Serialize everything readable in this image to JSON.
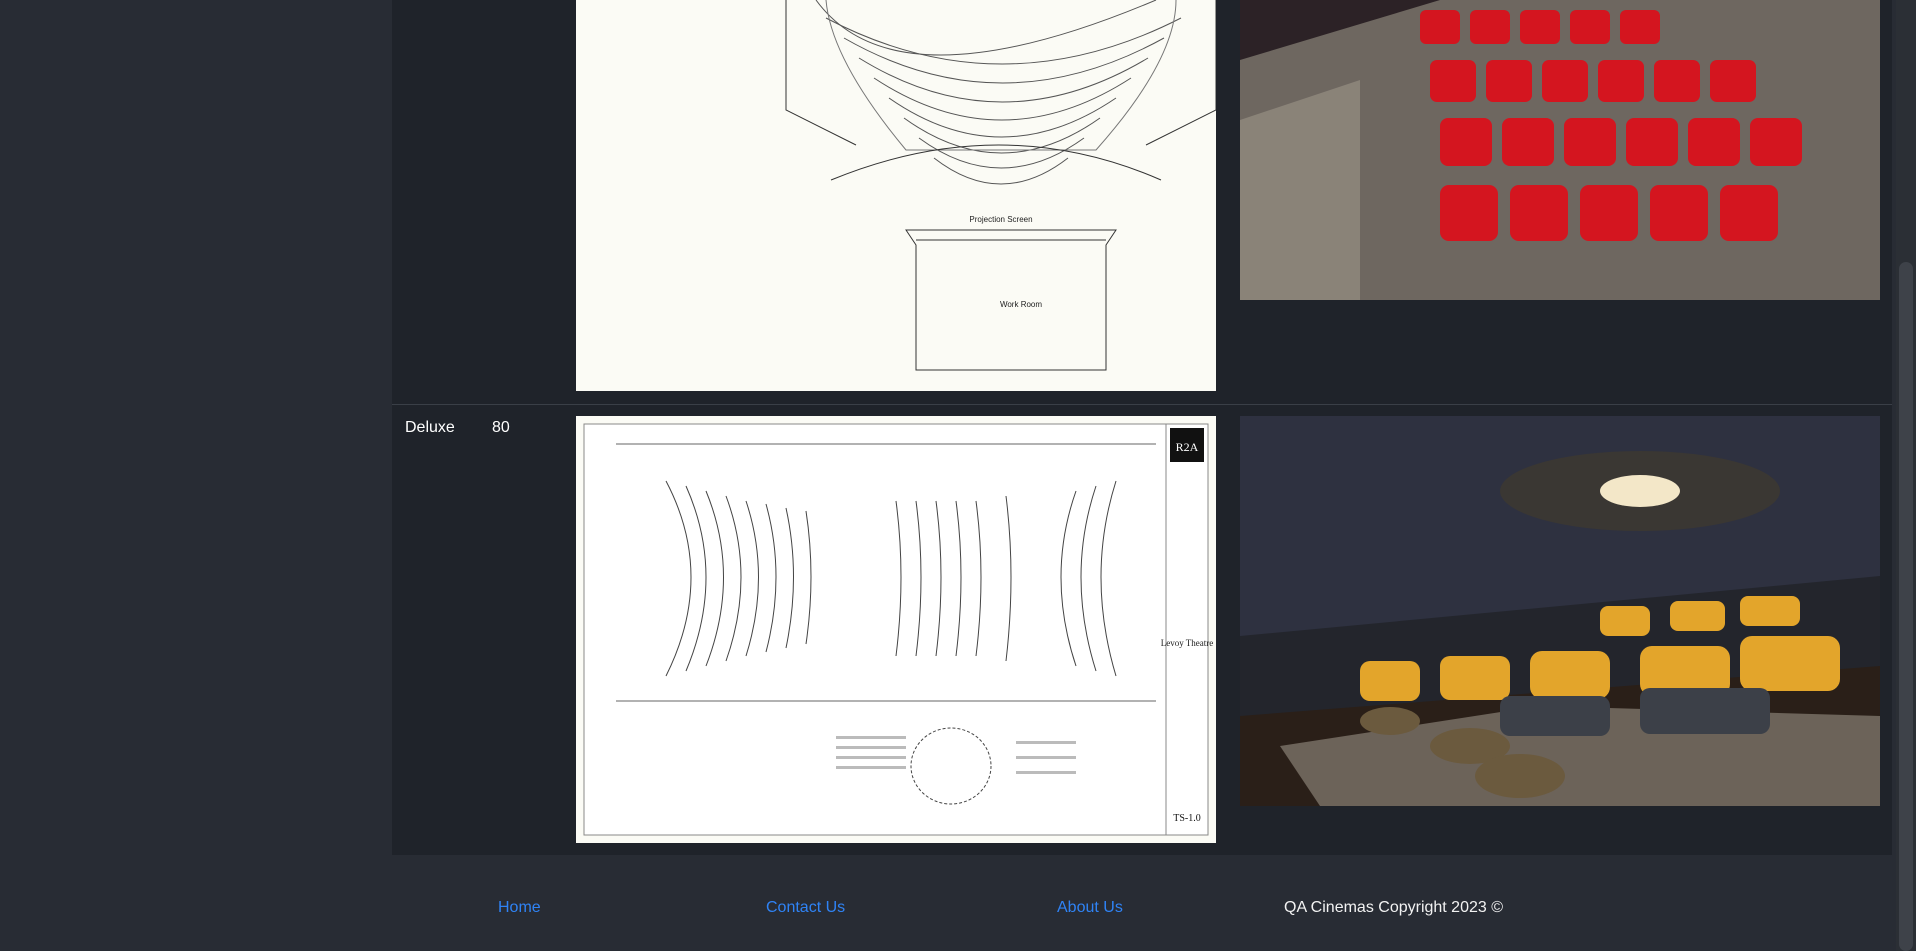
{
  "screens_table": {
    "rows": [
      {
        "name": "",
        "capacity": "",
        "plan_alt": "Standard screen seating plan",
        "photo_alt": "Standard screen red seats"
      },
      {
        "name": "Deluxe",
        "capacity": "80",
        "plan_alt": "Deluxe screen seating plan",
        "photo_alt": "Deluxe screen lounge seating"
      }
    ],
    "plan_labels": {
      "projection": "Projection Screen",
      "work_room": "Work Room",
      "sheet": "TS-1.0",
      "theatre": "Levoy Theatre",
      "firm": "R2A"
    }
  },
  "footer": {
    "home": "Home",
    "contact": "Contact Us",
    "about": "About Us",
    "copyright": "QA Cinemas Copyright 2023 ©"
  },
  "colors": {
    "page_bg": "#282c34",
    "table_bg": "#1f232a",
    "link": "#2f83f5",
    "seat_red": "#d4151f",
    "seat_gold": "#e3a52b"
  }
}
